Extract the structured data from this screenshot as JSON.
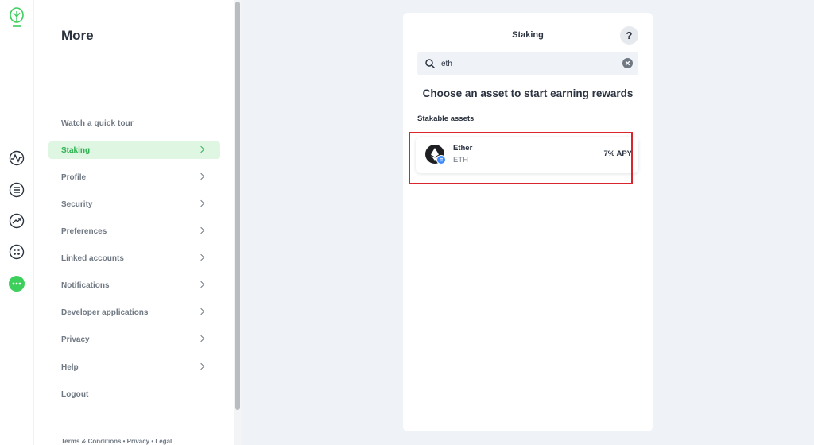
{
  "rail": {
    "icons": [
      "logo-icon",
      "activity-icon",
      "list-icon",
      "trending-icon",
      "apps-icon",
      "more-icon"
    ]
  },
  "panel": {
    "title": "More",
    "watch_tour": "Watch a quick tour",
    "items": [
      {
        "label": "Staking",
        "active": true
      },
      {
        "label": "Profile"
      },
      {
        "label": "Security"
      },
      {
        "label": "Preferences"
      },
      {
        "label": "Linked accounts"
      },
      {
        "label": "Notifications"
      },
      {
        "label": "Developer applications"
      },
      {
        "label": "Privacy"
      },
      {
        "label": "Help"
      }
    ],
    "logout": "Logout",
    "footer": "Terms & Conditions • Privacy • Legal"
  },
  "card": {
    "title": "Staking",
    "help": "?",
    "search": {
      "value": "eth",
      "placeholder": ""
    },
    "headline": "Choose an asset to start earning rewards",
    "section_label": "Stakable assets",
    "assets": [
      {
        "name": "Ether",
        "ticker": "ETH",
        "apy": "7% APY"
      }
    ]
  },
  "colors": {
    "accent": "#2cb24e",
    "accent_bg": "#dff6e3",
    "highlight": "#d9262e",
    "background": "#eff2f7"
  }
}
